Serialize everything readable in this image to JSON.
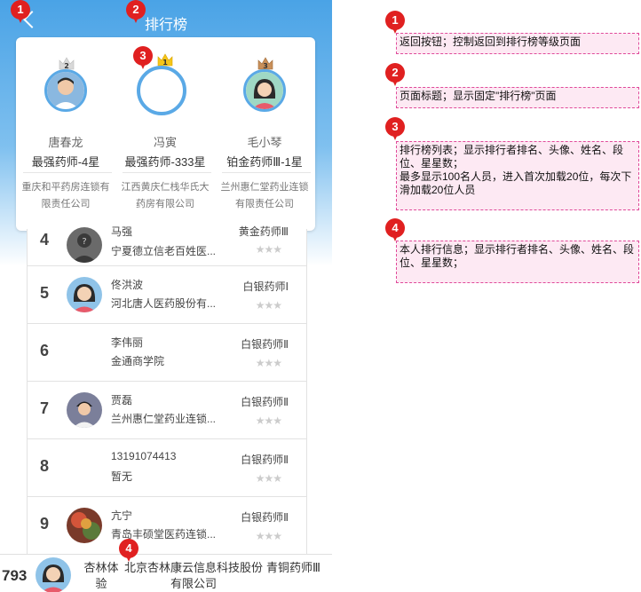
{
  "header": {
    "title": "排行榜"
  },
  "podium": [
    {
      "rank": "2",
      "name": "唐春龙",
      "level": "最强药师-4星",
      "company": "重庆和平药房连锁有限责任公司"
    },
    {
      "rank": "1",
      "name": "冯寅",
      "level": "最强药师-333星",
      "company": "江西黄庆仁栈华氏大药房有限公司"
    },
    {
      "rank": "3",
      "name": "毛小琴",
      "level": "铂金药师Ⅲ-1星",
      "company": "兰州惠仁堂药业连锁有限责任公司"
    }
  ],
  "list": [
    {
      "rank": "4",
      "name": "马强",
      "company": "宁夏德立信老百姓医...",
      "level": "黄金药师Ⅲ",
      "stars": "★★★"
    },
    {
      "rank": "5",
      "name": "佟洪波",
      "company": "河北唐人医药股份有...",
      "level": "白银药师Ⅰ",
      "stars": "★★★"
    },
    {
      "rank": "6",
      "name": "李伟丽",
      "company": "金通商学院",
      "level": "白银药师Ⅱ",
      "stars": "★★★"
    },
    {
      "rank": "7",
      "name": "贾磊",
      "company": "兰州惠仁堂药业连锁...",
      "level": "白银药师Ⅱ",
      "stars": "★★★"
    },
    {
      "rank": "8",
      "name": "13191074413",
      "company": "暂无",
      "level": "白银药师Ⅱ",
      "stars": "★★★"
    },
    {
      "rank": "9",
      "name": "亢宁",
      "company": "青岛丰硕堂医药连锁...",
      "level": "白银药师Ⅱ",
      "stars": "★★★"
    }
  ],
  "me": {
    "rank": "793",
    "name": "杏林体验",
    "company": "北京杏林康云信息科技股份有限公司",
    "level": "青铜药师Ⅲ"
  },
  "markers": [
    "1",
    "2",
    "3",
    "4"
  ],
  "notes": [
    "返回按钮；控制返回到排行榜等级页面",
    "页面标题；显示固定\"排行榜\"页面",
    "排行榜列表；显示排行者排名、头像、姓名、段位、星星数；\n最多显示100名人员，进入首次加载20位，每次下滑加载20位人员",
    "本人排行信息；显示排行者排名、头像、姓名、段位、星星数；"
  ],
  "colors": {
    "header": "#4aa3e6",
    "marker": "#e02020",
    "note_bg": "#fde9f3",
    "note_border": "#e04a9a"
  }
}
